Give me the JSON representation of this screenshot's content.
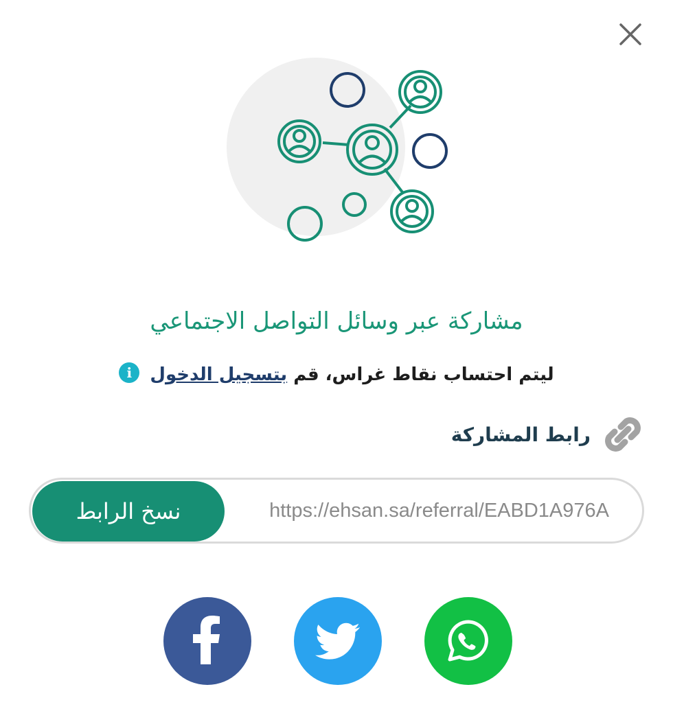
{
  "dialog": {
    "title": "مشاركة عبر وسائل التواصل الاجتماعي",
    "note_prefix": "ليتم احتساب نقاط غراس، قم ",
    "note_link": "بتسجيل الدخول",
    "info_glyph": "i"
  },
  "share": {
    "label": "رابط المشاركة",
    "url": "https://ehsan.sa/referral/EABD1A976A",
    "copy_label": "نسخ الرابط"
  },
  "social_buttons": [
    {
      "name": "facebook",
      "icon": "facebook-icon",
      "color": "#3b5998"
    },
    {
      "name": "twitter",
      "icon": "twitter-icon",
      "color": "#2aa3ef"
    },
    {
      "name": "whatsapp",
      "icon": "whatsapp-icon",
      "color": "#12c045"
    }
  ],
  "colors": {
    "accent": "#178f74",
    "title": "#1a9677",
    "link": "#1f3d6b",
    "info": "#1bb3c8",
    "network_dark": "#1f3d6b"
  },
  "icons": {
    "close": "close-icon",
    "hero": "social-network-illustration",
    "link": "link-icon",
    "info": "info-icon"
  }
}
